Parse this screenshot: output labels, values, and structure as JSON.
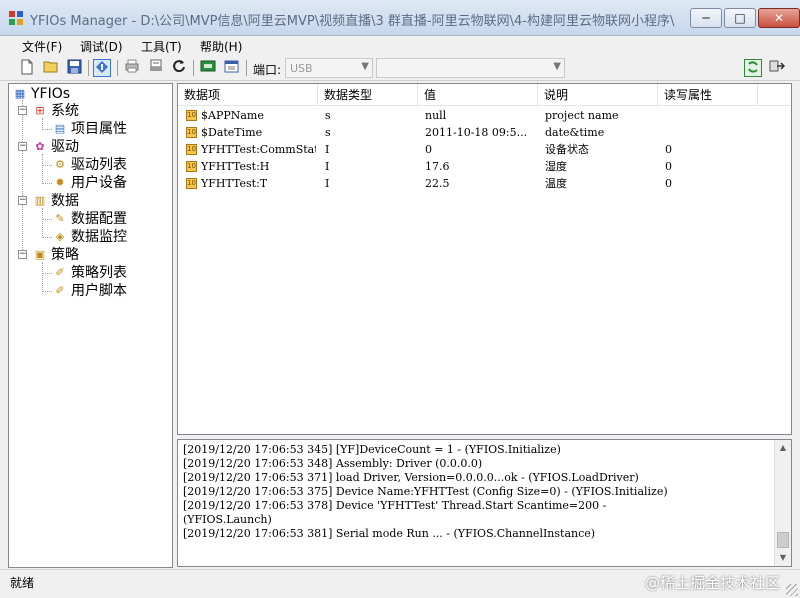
{
  "window": {
    "title": "YFIOs Manager - D:\\公司\\MVP信息\\阿里云MVP\\视频直播\\3 群直播-阿里云物联网\\4-构建阿里云物联网小程序\\动手实...",
    "minimize_label": "─",
    "maximize_label": "□",
    "close_label": "✕"
  },
  "menu": {
    "items": [
      "文件(F)",
      "调试(D)",
      "工具(T)",
      "帮助(H)"
    ]
  },
  "toolbar": {
    "port_label": "端口:",
    "port_value": "USB",
    "port_detail_value": "",
    "icons": [
      "new-icon",
      "open-icon",
      "save-icon",
      "info-icon",
      "print-icon",
      "print-preview-icon",
      "refresh-icon",
      "connect-icon",
      "calendar-icon",
      "run-icon",
      "exit-icon"
    ]
  },
  "tree": {
    "root": "YFIOs",
    "nodes": [
      {
        "label": "系统",
        "children": [
          "项目属性"
        ]
      },
      {
        "label": "驱动",
        "children": [
          "驱动列表",
          "用户设备"
        ]
      },
      {
        "label": "数据",
        "children": [
          "数据配置",
          "数据监控"
        ]
      },
      {
        "label": "策略",
        "children": [
          "策略列表",
          "用户脚本"
        ]
      }
    ]
  },
  "list": {
    "columns": [
      "数据项",
      "数据类型",
      "值",
      "说明",
      "读写属性"
    ],
    "rows": [
      {
        "name": "$APPName",
        "type": "s",
        "value": "null",
        "desc": "project name",
        "rw": ""
      },
      {
        "name": "$DateTime",
        "type": "s",
        "value": "2011-10-18 09:5...",
        "desc": "date&time",
        "rw": ""
      },
      {
        "name": "YFHTTest:CommState",
        "type": "I",
        "value": "0",
        "desc": "设备状态",
        "rw": "0"
      },
      {
        "name": "YFHTTest:H",
        "type": "I",
        "value": "17.6",
        "desc": "湿度",
        "rw": "0"
      },
      {
        "name": "YFHTTest:T",
        "type": "I",
        "value": "22.5",
        "desc": "温度",
        "rw": "0"
      }
    ]
  },
  "log": {
    "lines": [
      "[2019/12/20 17:06:53 345] [YF]DeviceCount = 1 - (YFIOS.Initialize)",
      "[2019/12/20 17:06:53 348] Assembly: Driver (0.0.0.0)",
      "[2019/12/20 17:06:53 371] load Driver, Version=0.0.0.0...ok - (YFIOS.LoadDriver)",
      "[2019/12/20 17:06:53 375] Device Name:YFHTTest (Config Size=0) - (YFIOS.Initialize)",
      "[2019/12/20 17:06:53 378] Device 'YFHTTest' Thread.Start Scantime=200 -",
      "(YFIOS.Launch)",
      "[2019/12/20 17:06:53 381] Serial mode Run ... - (YFIOS.ChannelInstance)"
    ]
  },
  "status": {
    "text": "就绪",
    "watermark": "@稀土掘金技术社区"
  }
}
